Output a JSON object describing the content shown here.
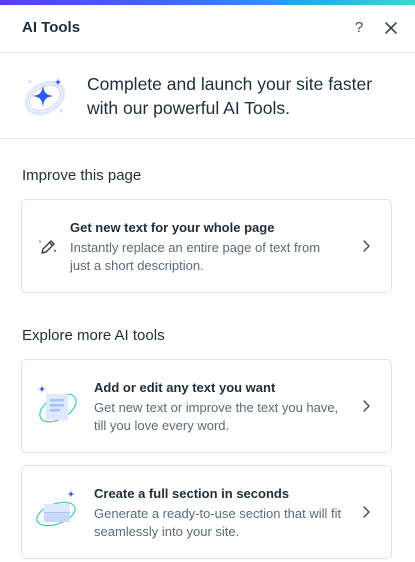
{
  "header": {
    "title": "AI Tools",
    "help_label": "?",
    "close_icon": "close-icon"
  },
  "intro": {
    "icon": "sparkles-icon",
    "text": "Complete and launch your site faster with our powerful AI Tools."
  },
  "improve_section": {
    "title": "Improve this page",
    "cards": [
      {
        "title": "Get new text for your whole page",
        "description": "Instantly replace an entire page of text from just a short description.",
        "icon": "magic-pen-icon"
      }
    ]
  },
  "explore_section": {
    "title": "Explore more AI tools",
    "cards": [
      {
        "title": "Add or edit any text you want",
        "description": "Get new text or improve the text you have, till you love every word.",
        "icon": "ai-text-icon"
      },
      {
        "title": "Create a full section in seconds",
        "description": "Generate a ready-to-use section that will fit seamlessly into your site.",
        "icon": "ai-section-icon"
      }
    ]
  },
  "colors": {
    "accent_gradient_start": "#5b3cf5",
    "accent_gradient_end": "#3ad9cf",
    "sparkle_blue": "#2f5bf0",
    "text_primary": "#1f2d3a",
    "text_secondary": "#5b6a78",
    "border": "#dfe3e8"
  }
}
